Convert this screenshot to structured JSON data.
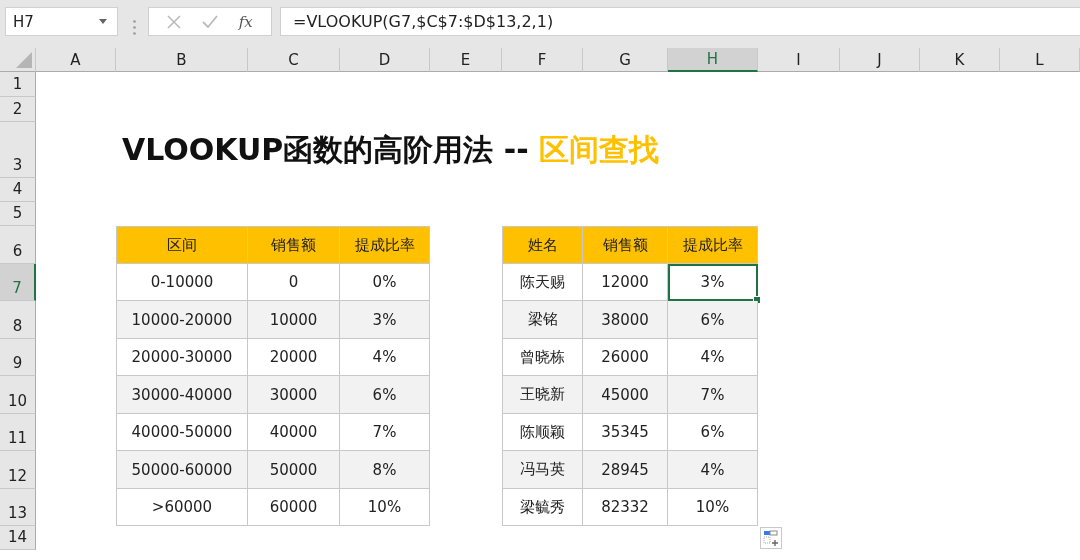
{
  "name_box": {
    "value": "H7"
  },
  "formula_bar": {
    "fx": "fx",
    "formula": "=VLOOKUP(G7,$C$7:$D$13,2,1)"
  },
  "columns": [
    {
      "label": "A",
      "selected": false
    },
    {
      "label": "B",
      "selected": false
    },
    {
      "label": "C",
      "selected": false
    },
    {
      "label": "D",
      "selected": false
    },
    {
      "label": "E",
      "selected": false
    },
    {
      "label": "F",
      "selected": false
    },
    {
      "label": "G",
      "selected": false
    },
    {
      "label": "H",
      "selected": true
    },
    {
      "label": "I",
      "selected": false
    },
    {
      "label": "J",
      "selected": false
    },
    {
      "label": "K",
      "selected": false
    },
    {
      "label": "L",
      "selected": false
    }
  ],
  "rows": [
    {
      "label": "1",
      "selected": false
    },
    {
      "label": "2",
      "selected": false
    },
    {
      "label": "3",
      "selected": false
    },
    {
      "label": "4",
      "selected": false
    },
    {
      "label": "5",
      "selected": false
    },
    {
      "label": "6",
      "selected": false
    },
    {
      "label": "7",
      "selected": true
    },
    {
      "label": "8",
      "selected": false
    },
    {
      "label": "9",
      "selected": false
    },
    {
      "label": "10",
      "selected": false
    },
    {
      "label": "11",
      "selected": false
    },
    {
      "label": "12",
      "selected": false
    },
    {
      "label": "13",
      "selected": false
    },
    {
      "label": "14",
      "selected": false
    }
  ],
  "title": {
    "text": "VLOOKUP函数的高阶用法 -- ",
    "highlight": "区间查找"
  },
  "tables": [
    {
      "columns": [
        "区间",
        "销售额",
        "提成比率"
      ],
      "rows": [
        [
          {
            "text": "0-10000",
            "selected": false
          },
          {
            "text": "0",
            "selected": false
          },
          {
            "text": "0%",
            "selected": false
          }
        ],
        [
          {
            "text": "10000-20000",
            "selected": false
          },
          {
            "text": "10000",
            "selected": false
          },
          {
            "text": "3%",
            "selected": false
          }
        ],
        [
          {
            "text": "20000-30000",
            "selected": false
          },
          {
            "text": "20000",
            "selected": false
          },
          {
            "text": "4%",
            "selected": false
          }
        ],
        [
          {
            "text": "30000-40000",
            "selected": false
          },
          {
            "text": "30000",
            "selected": false
          },
          {
            "text": "6%",
            "selected": false
          }
        ],
        [
          {
            "text": "40000-50000",
            "selected": false
          },
          {
            "text": "40000",
            "selected": false
          },
          {
            "text": "7%",
            "selected": false
          }
        ],
        [
          {
            "text": "50000-60000",
            "selected": false
          },
          {
            "text": "50000",
            "selected": false
          },
          {
            "text": "8%",
            "selected": false
          }
        ],
        [
          {
            "text": ">60000",
            "selected": false
          },
          {
            "text": "60000",
            "selected": false
          },
          {
            "text": "10%",
            "selected": false
          }
        ]
      ]
    },
    {
      "columns": [
        "姓名",
        "销售额",
        "提成比率"
      ],
      "rows": [
        [
          {
            "text": "陈天赐",
            "selected": false
          },
          {
            "text": "12000",
            "selected": false
          },
          {
            "text": "3%",
            "selected": true
          }
        ],
        [
          {
            "text": "梁铭",
            "selected": false
          },
          {
            "text": "38000",
            "selected": false
          },
          {
            "text": "6%",
            "selected": false
          }
        ],
        [
          {
            "text": "曾晓栋",
            "selected": false
          },
          {
            "text": "26000",
            "selected": false
          },
          {
            "text": "4%",
            "selected": false
          }
        ],
        [
          {
            "text": "王晓新",
            "selected": false
          },
          {
            "text": "45000",
            "selected": false
          },
          {
            "text": "7%",
            "selected": false
          }
        ],
        [
          {
            "text": "陈顺颖",
            "selected": false
          },
          {
            "text": "35345",
            "selected": false
          },
          {
            "text": "6%",
            "selected": false
          }
        ],
        [
          {
            "text": "冯马英",
            "selected": false
          },
          {
            "text": "28945",
            "selected": false
          },
          {
            "text": "4%",
            "selected": false
          }
        ],
        [
          {
            "text": "梁毓秀",
            "selected": false
          },
          {
            "text": "82332",
            "selected": false
          },
          {
            "text": "10%",
            "selected": false
          }
        ]
      ]
    }
  ]
}
